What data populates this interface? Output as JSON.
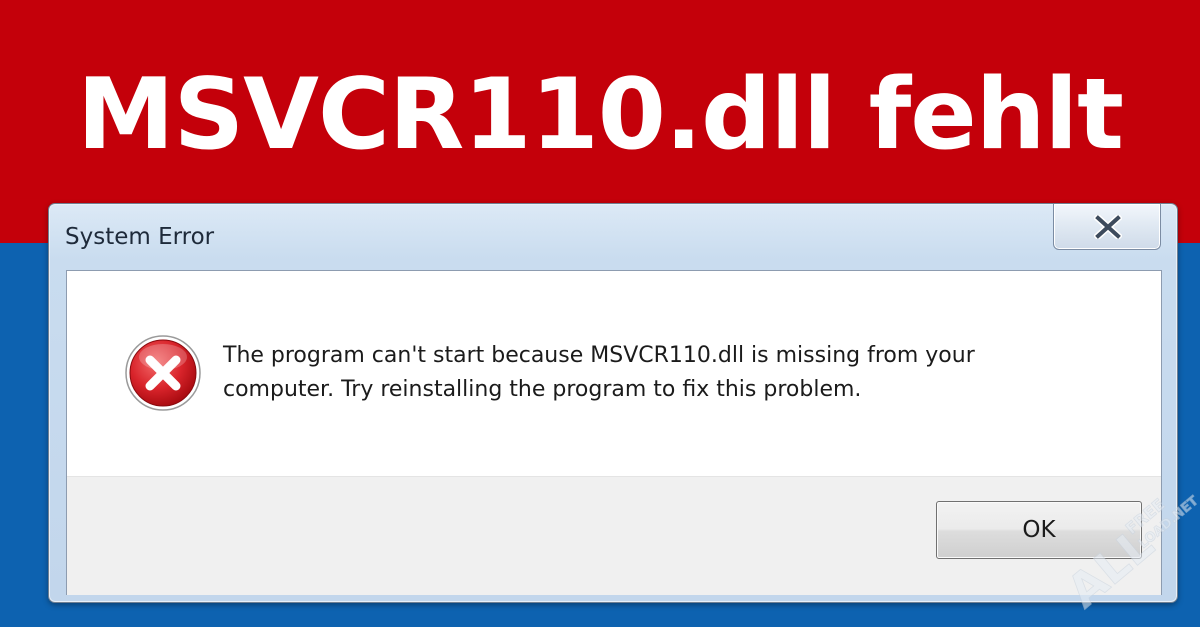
{
  "banner": {
    "headline": "MSVCR110.dll fehlt"
  },
  "dialog": {
    "title": "System Error",
    "message_line1": "The program can't start because MSVCR110.dll is missing from your",
    "message_line2": "computer. Try reinstalling the program to fix this problem.",
    "ok_label": "OK",
    "icons": {
      "error": "error-icon",
      "close": "close-icon"
    }
  },
  "watermark": {
    "text": "ALL",
    "sub1": "FREE",
    "sub2": "LOAD.NET"
  },
  "colors": {
    "banner_red": "#c4000a",
    "background_blue": "#0d62b0",
    "error_red": "#d9242b",
    "text": "#1b1b1b"
  }
}
